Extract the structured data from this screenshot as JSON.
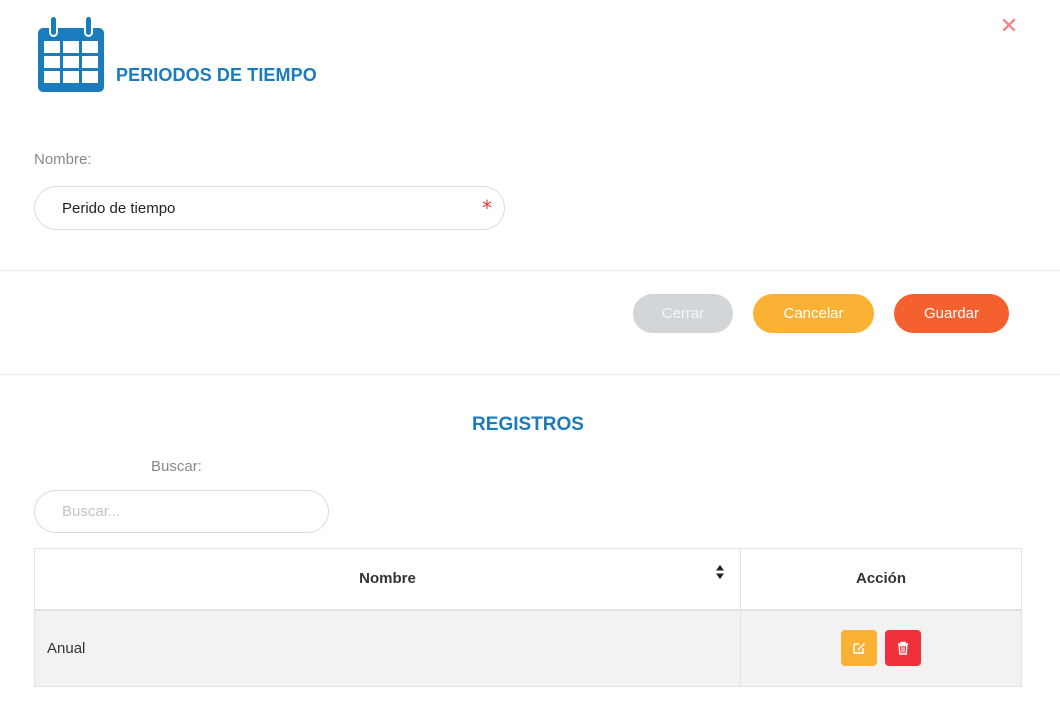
{
  "header": {
    "title": "PERIODOS DE TIEMPO",
    "icon": "calendar-icon",
    "close_icon": "close-icon",
    "close_symbol": "✕"
  },
  "form": {
    "name_label": "Nombre:",
    "name_value": "Perido de tiempo",
    "required_mark": "*"
  },
  "buttons": {
    "close": "Cerrar",
    "cancel": "Cancelar",
    "save": "Guardar"
  },
  "records": {
    "title": "REGISTROS",
    "search_label": "Buscar:",
    "search_placeholder": "Buscar...",
    "search_value": "",
    "columns": [
      "Nombre",
      "Acción"
    ],
    "rows": [
      {
        "name": "Anual",
        "actions": [
          "edit-icon",
          "trash-icon"
        ]
      }
    ]
  },
  "colors": {
    "accent": "#1a7bbd",
    "close": "#f08080",
    "btn_close": "#d3d6d9",
    "btn_cancel": "#fbb234",
    "btn_save": "#f5602f",
    "edit": "#fbb234",
    "delete": "#f0303a"
  }
}
